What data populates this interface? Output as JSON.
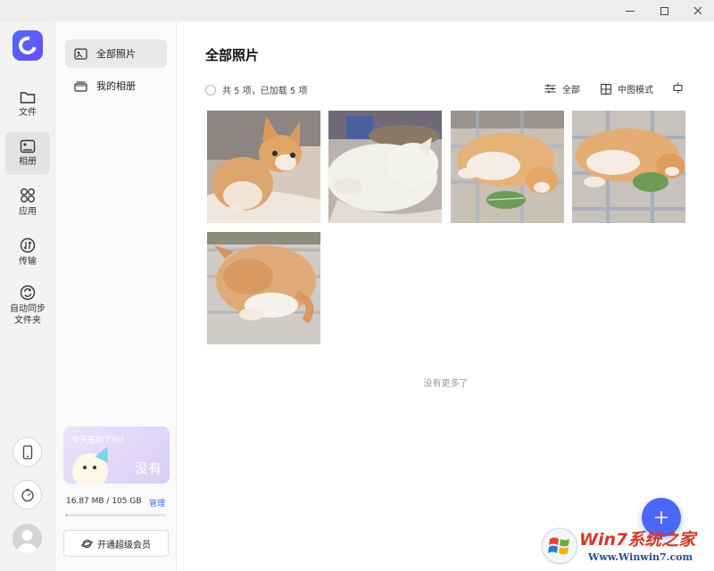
{
  "rail": {
    "items": [
      {
        "label": "文件",
        "icon": "folder-icon"
      },
      {
        "label": "相册",
        "icon": "photo-album-icon"
      },
      {
        "label": "应用",
        "icon": "apps-grid-icon"
      },
      {
        "label": "传输",
        "icon": "transfer-icon"
      },
      {
        "label": "自动同步\n文件夹",
        "icon": "sync-icon"
      }
    ],
    "bottom_icons": [
      "phone-icon",
      "timer-icon",
      "avatar-icon"
    ]
  },
  "album_nav": {
    "items": [
      {
        "label": "全部照片",
        "icon": "image-icon",
        "active": true
      },
      {
        "label": "我的相册",
        "icon": "album-stack-icon",
        "active": false
      }
    ]
  },
  "promo": {
    "title": "今天签到了吗?",
    "right_text": "没有"
  },
  "storage": {
    "used": "16.87 MB / 105 GB",
    "manage_label": "管理",
    "fraction_used": 0.0002
  },
  "vip_button": {
    "label": "开通超级会员"
  },
  "main": {
    "title": "全部照片",
    "count_text": "共 5 项，已加载 5 项",
    "filter_label": "全部",
    "view_mode_label": "中图模式",
    "photo_count": 5,
    "no_more_text": "没有更多了"
  },
  "watermark": {
    "title": "Win7系统之家",
    "url": "Www.Winwin7.com"
  },
  "colors": {
    "accent": "#4a67f6",
    "manage_link": "#3b6ef5",
    "watermark_red": "#d23a2a"
  }
}
